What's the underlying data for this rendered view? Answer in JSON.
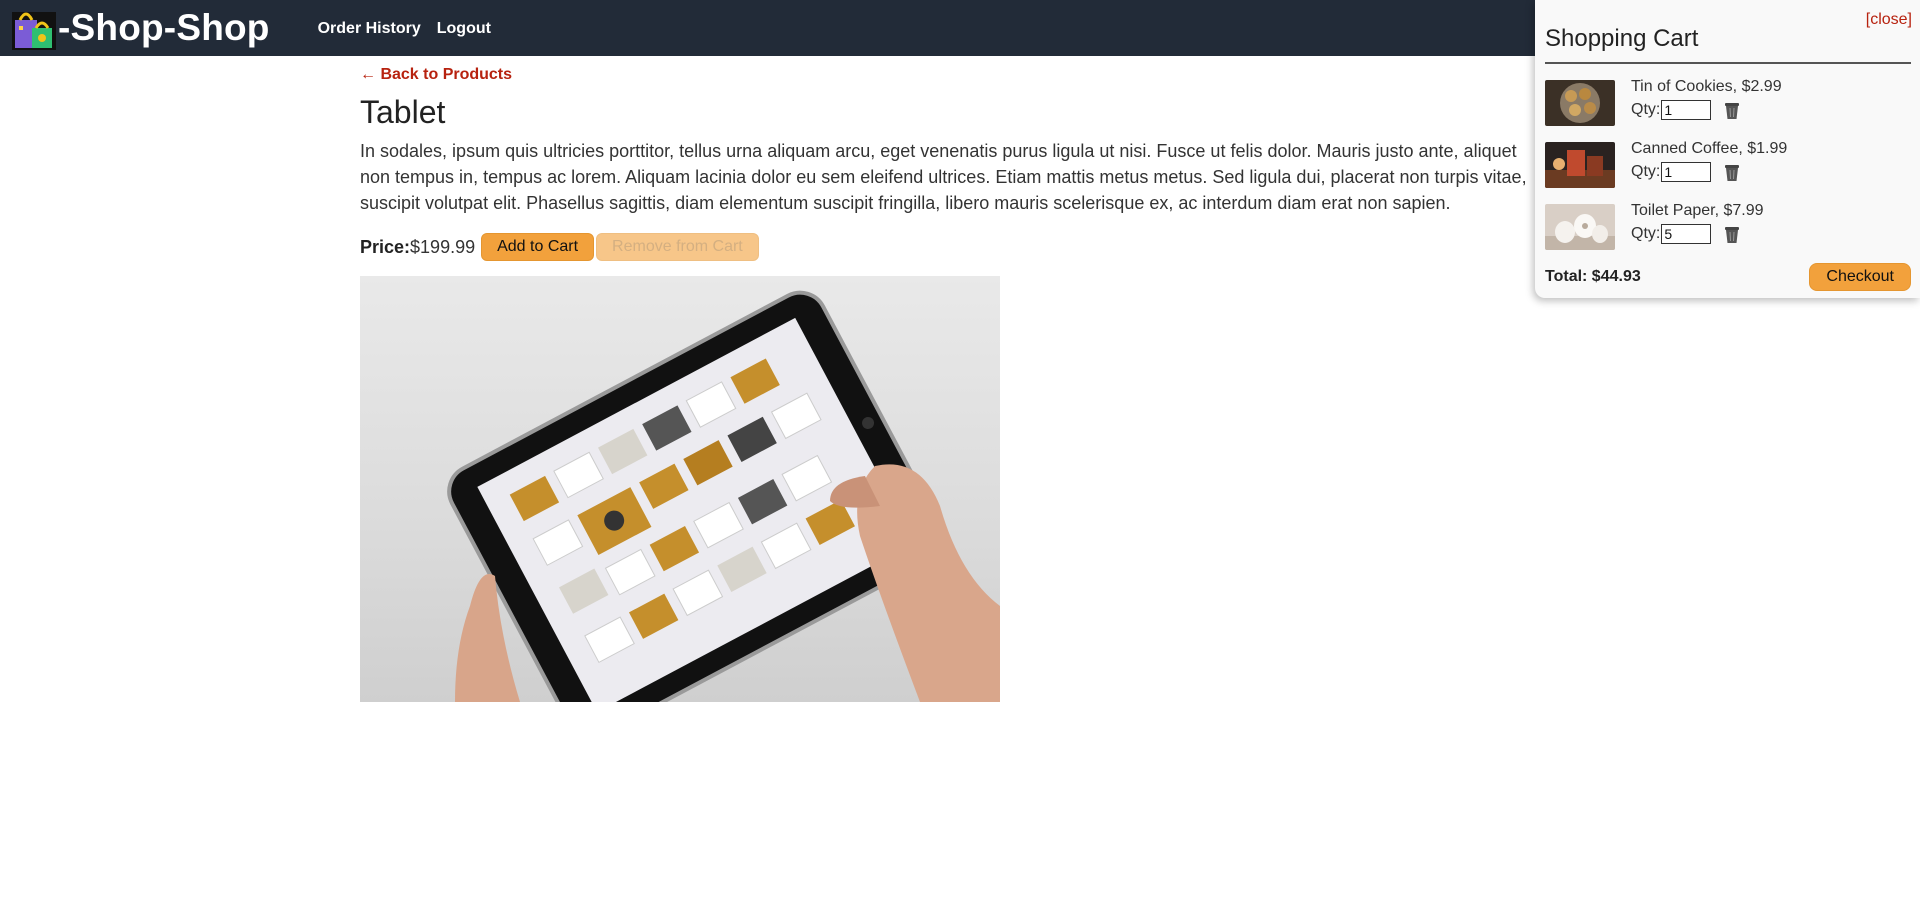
{
  "header": {
    "title": "-Shop-Shop",
    "nav": [
      {
        "label": "Order History"
      },
      {
        "label": "Logout"
      }
    ]
  },
  "product": {
    "back_label": "← Back to Products",
    "name": "Tablet",
    "description": "In sodales, ipsum quis ultricies porttitor, tellus urna aliquam arcu, eget venenatis purus ligula ut nisi. Fusce ut felis dolor. Mauris justo ante, aliquet non tempus in, tempus ac lorem. Aliquam lacinia dolor eu sem eleifend ultrices. Etiam mattis metus metus. Sed ligula dui, placerat non turpis vitae, suscipit volutpat elit. Phasellus sagittis, diam elementum suscipit fringilla, libero mauris scelerisque ex, ac interdum diam erat non sapien.",
    "price_label": "Price:",
    "price_value": "$199.99",
    "add_label": "Add to Cart",
    "remove_label": "Remove from Cart"
  },
  "cart": {
    "close_label": "[close]",
    "title": "Shopping Cart",
    "items": [
      {
        "name": "Tin of Cookies, $2.99",
        "qty_label": "Qty:",
        "qty": "1"
      },
      {
        "name": "Canned Coffee, $1.99",
        "qty_label": "Qty:",
        "qty": "1"
      },
      {
        "name": "Toilet Paper, $7.99",
        "qty_label": "Qty:",
        "qty": "5"
      }
    ],
    "total": "Total: $44.93",
    "checkout_label": "Checkout"
  },
  "colors": {
    "header_bg": "#222b38",
    "accent": "#f2a13c",
    "link": "#b7220f"
  }
}
